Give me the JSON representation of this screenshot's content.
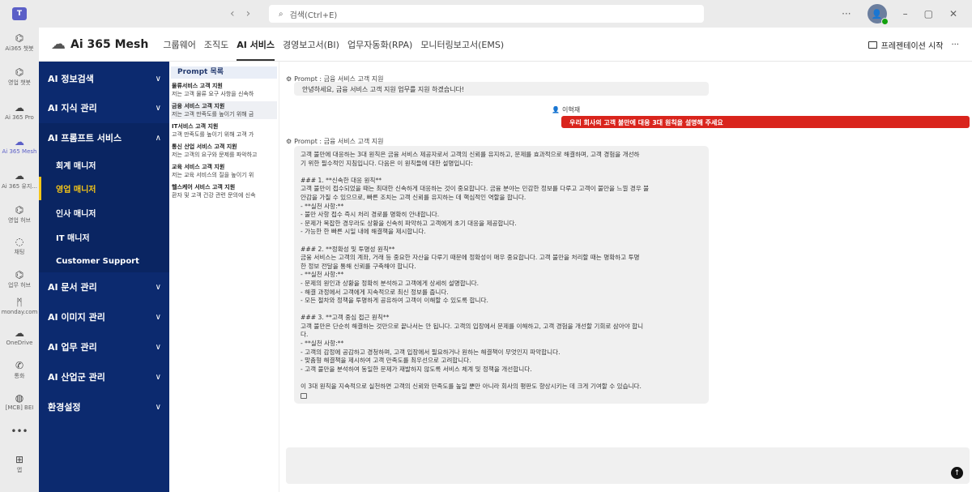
{
  "titlebar": {
    "search_placeholder": "검색(Ctrl+E)",
    "more": "···",
    "minimize": "–",
    "restore": "▢",
    "close": "✕"
  },
  "rail": [
    {
      "label": "Ai365 챗봇",
      "icon": "bot-icon"
    },
    {
      "label": "영업 챗봇",
      "icon": "bot-icon"
    },
    {
      "label": "Ai 365 Pro",
      "icon": "cloud-icon"
    },
    {
      "label": "Ai 365 Mesh",
      "icon": "cloud-icon"
    },
    {
      "label": "Ai 365 유지...",
      "icon": "cloud-icon"
    },
    {
      "label": "영업 허브",
      "icon": "bot-icon"
    },
    {
      "label": "채팅",
      "icon": "chat-icon"
    },
    {
      "label": "업무 허브",
      "icon": "bot-icon"
    },
    {
      "label": "monday.com",
      "icon": "monday-icon"
    },
    {
      "label": "OneDrive",
      "icon": "onedrive-icon"
    },
    {
      "label": "통화",
      "icon": "phone-icon"
    },
    {
      "label": "[MCB] BEI",
      "icon": "globe-icon"
    },
    {
      "label": "",
      "icon": "more-icon"
    },
    {
      "label": "앱",
      "icon": "add-app-icon"
    }
  ],
  "header": {
    "brand": "Ai 365 Mesh",
    "tabs": [
      "그룹웨어",
      "조직도",
      "AI 서비스",
      "경영보고서(BI)",
      "업무자동화(RPA)",
      "모니터링보고서(EMS)"
    ],
    "active_tab": "AI 서비스",
    "present_label": "프레젠테이션 시작",
    "more": "···"
  },
  "menu": {
    "items": [
      {
        "label": "AI 정보검색",
        "chevron": "∨"
      },
      {
        "label": "AI 지식 관리",
        "chevron": "∨"
      },
      {
        "label": "AI 프롬프트 서비스",
        "chevron": "∧"
      },
      {
        "label": "AI 문서 관리",
        "chevron": "∨"
      },
      {
        "label": "AI 이미지 관리",
        "chevron": "∨"
      },
      {
        "label": "AI 업무 관리",
        "chevron": "∨"
      },
      {
        "label": "AI 산업군 관리",
        "chevron": "∨"
      },
      {
        "label": "환경설정",
        "chevron": "∨"
      }
    ],
    "subitems": [
      "회계 매니저",
      "영업 매니저",
      "인사 매니저",
      "IT 매니저",
      "Customer Support"
    ],
    "active_sub": "영업 매니저"
  },
  "prompt_list": {
    "title": "Prompt 목록",
    "items": [
      {
        "title": "물류서비스 고객 지원",
        "desc": "저는 고객 물류 요구 사항을 신속하"
      },
      {
        "title": "금융 서비스 고객 지원",
        "desc": "저는 고객 만족도를 높이기 위해 금"
      },
      {
        "title": "IT서비스 고객 지원",
        "desc": "고객 만족도를 높이기 위해 고객 가"
      },
      {
        "title": "통신 산업 서비스 고객 지원",
        "desc": "저는 고객의 요구와 문제를 파악하고"
      },
      {
        "title": "교육 서비스 고객 지원",
        "desc": "저는 교육 서비스의 질을 높이기 위"
      },
      {
        "title": "헬스케어 서비스 고객 지원",
        "desc": "환자 및 고객 건강 관련 문의에 신속"
      }
    ]
  },
  "chat": {
    "prompt_label_1": "Prompt : 금융 서비스 고객 지원",
    "greeting": "안녕하세요, 금융 서비스 고객 지원 업무를 지원 하겠습니다!",
    "user_name": "이혁재",
    "user_message": "우리 회사의 고객 불만에 대응 3대 원칙을 설명해 주세요",
    "prompt_label_2": "Prompt : 금융 서비스 고객 지원",
    "answer_lines": [
      "고객 불만에 대응하는 3대 원칙은 금융 서비스 제공자로서 고객의 신뢰를 유지하고, 문제를 효과적으로 해결하며, 고객 경험을 개선하",
      "기 위한 필수적인 지침입니다. 다음은 이 원칙들에 대한 설명입니다:",
      "",
      "### 1. **신속한 대응 원칙**",
      "고객 불만이 접수되었을 때는 최대한 신속하게 대응하는 것이 중요합니다. 금융 분야는 민감한 정보를 다루고 고객이 불만을 느낄 경우 불",
      "안감을 가질 수 있으므로, 빠른 조치는 고객 신뢰를 유지하는 데 핵심적인 역할을 합니다.",
      "- **실천 사항:**",
      "- 불만 사항 접수 즉시 처리 경로를 명확히 안내합니다.",
      "- 문제가 복잡한 경우라도 상황을 신속히 파악하고 고객에게 초기 대응을 제공합니다.",
      "- 가능한 한 빠른 시일 내에 해결책을 제시합니다.",
      "",
      "### 2. **정확성 및 투명성 원칙**",
      "금융 서비스는 고객의 계좌, 거래 등 중요한 자산을 다루기 때문에 정확성이 매우 중요합니다. 고객 불만을 처리할 때는 명확하고 투명",
      "한 정보 전달을 통해 신뢰를 구축해야 합니다.",
      "- **실천 사항:**",
      "- 문제의 원인과 상황을 정확히 분석하고 고객에게 상세히 설명합니다.",
      "- 해결 과정에서 고객에게 지속적으로 최신 정보를 줍니다.",
      "- 모든 절차와 정책을 투명하게 공유하여 고객이 이해할 수 있도록 합니다.",
      "",
      "### 3. **고객 중심 접근 원칙**",
      "고객 불만은 단순히 해결하는 것만으로 끝나서는 안 됩니다. 고객의 입장에서 문제를 이해하고, 고객 경험을 개선할 기회로 삼아야 합니",
      "다.",
      "- **실천 사항:**",
      "- 고객의 감정에 공감하고 경청하며, 고객 입장에서 필요하거나 원하는 해결책이 무엇인지 파악합니다.",
      "- 맞춤형 해결책을 제시하여 고객 만족도를 최우선으로 고려합니다.",
      "- 고객 불만을 분석하여 동일한 문제가 재발하지 않도록 서비스 체계 및 정책을 개선합니다.",
      "",
      "이 3대 원칙을 지속적으로 실천하면 고객의 신뢰와 만족도를 높일 뿐만 아니라 회사의 평판도 향상시키는 데 크게 기여할 수 있습니다."
    ],
    "send_icon": "↑"
  },
  "colors": {
    "menu_bg": "#0c2a6f",
    "active_sub": "#f5c518",
    "user_bubble": "#d9241c",
    "brand_accent": "#5b5fc7"
  }
}
